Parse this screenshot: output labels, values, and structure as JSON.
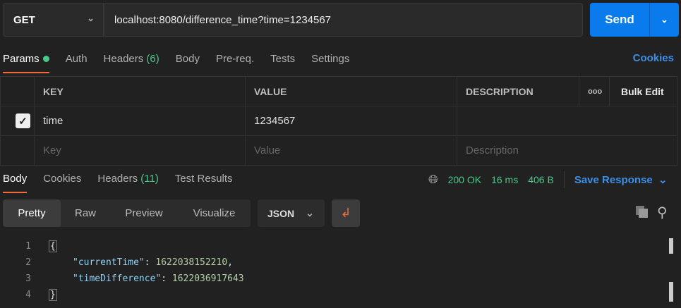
{
  "request": {
    "method": "GET",
    "url": "localhost:8080/difference_time?time=1234567",
    "send_label": "Send"
  },
  "req_tabs": [
    {
      "label": "Params"
    },
    {
      "label": "Auth"
    },
    {
      "label": "Headers",
      "count": "(6)"
    },
    {
      "label": "Body"
    },
    {
      "label": "Pre-req."
    },
    {
      "label": "Tests"
    },
    {
      "label": "Settings"
    }
  ],
  "cookies_link": "Cookies",
  "params": {
    "headers": {
      "key": "KEY",
      "value": "VALUE",
      "description": "DESCRIPTION",
      "more": "ooo",
      "bulk_edit": "Bulk Edit"
    },
    "rows": [
      {
        "checked": true,
        "key": "time",
        "value": "1234567",
        "description": ""
      }
    ],
    "placeholders": {
      "key": "Key",
      "value": "Value",
      "description": "Description"
    }
  },
  "resp_tabs": [
    {
      "label": "Body"
    },
    {
      "label": "Cookies"
    },
    {
      "label": "Headers",
      "count": "(11)"
    },
    {
      "label": "Test Results"
    }
  ],
  "status": {
    "code": "200 OK",
    "time": "16 ms",
    "size": "406 B",
    "save_label": "Save Response"
  },
  "view_modes": [
    "Pretty",
    "Raw",
    "Preview",
    "Visualize"
  ],
  "format": "JSON",
  "code_lines": [
    {
      "n": "1",
      "text": "{"
    },
    {
      "n": "2",
      "key": "\"currentTime\"",
      "value": "1622038152210",
      "suffix": ","
    },
    {
      "n": "3",
      "key": "\"timeDifference\"",
      "value": "1622036917643",
      "suffix": ""
    },
    {
      "n": "4",
      "text": "}"
    }
  ]
}
